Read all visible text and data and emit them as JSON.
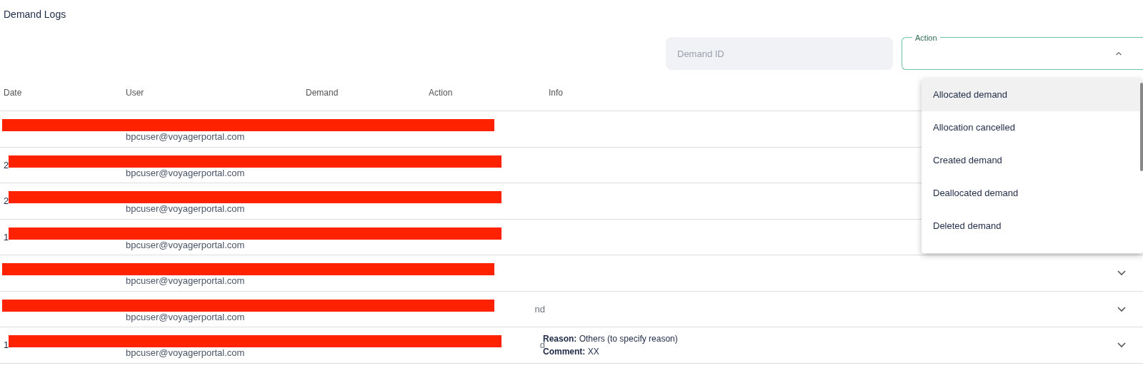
{
  "title": "Demand Logs",
  "filters": {
    "demand_id": {
      "placeholder": "Demand ID"
    },
    "action": {
      "label": "Action",
      "expanded": true,
      "options": [
        {
          "label": "Allocated demand",
          "selected": true
        },
        {
          "label": "Allocation cancelled",
          "selected": false
        },
        {
          "label": "Created demand",
          "selected": false
        },
        {
          "label": "Deallocated demand",
          "selected": false
        },
        {
          "label": "Deleted demand",
          "selected": false
        }
      ]
    }
  },
  "table": {
    "columns": [
      "Date",
      "User",
      "Demand",
      "Action",
      "Info"
    ],
    "rows": [
      {
        "redacted": true,
        "user_email": "bpcuser@voyagerportal.com"
      },
      {
        "redacted": true,
        "date": "2",
        "user_email": "bpcuser@voyagerportal.com"
      },
      {
        "redacted": true,
        "date": "2",
        "user_email": "bpcuser@voyagerportal.com"
      },
      {
        "redacted": true,
        "date": "1",
        "user_email": "bpcuser@voyagerportal.com"
      },
      {
        "redacted": true,
        "user_email": "bpcuser@voyagerportal.com",
        "expand_icon": true
      },
      {
        "redacted": true,
        "user_email": "bpcuser@voyagerportal.com",
        "action": "nd",
        "expand_icon": true
      },
      {
        "redacted": true,
        "date": "1",
        "user_email": "bpcuser@voyagerportal.com",
        "action": "d",
        "info": [
          "**Reason:** Others (to specify reason)",
          "**Comment:** XX"
        ],
        "expand_icon": true
      }
    ]
  }
}
